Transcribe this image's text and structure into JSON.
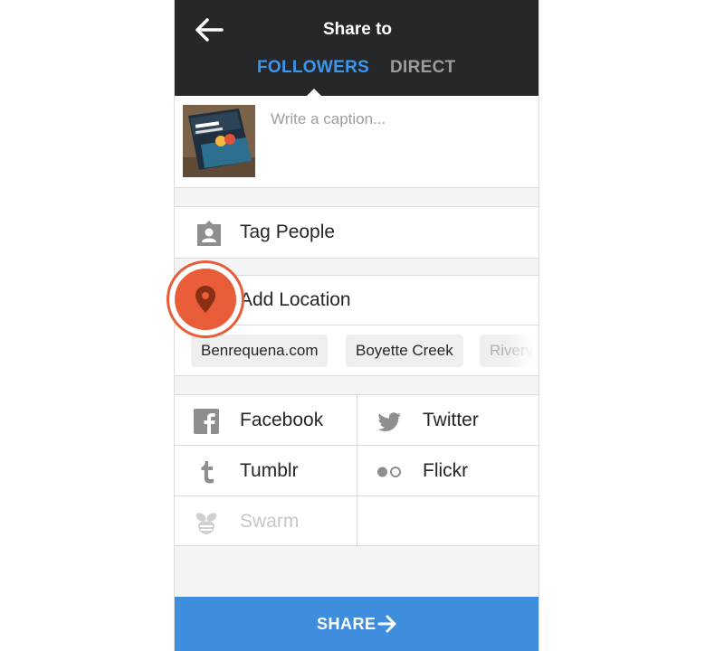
{
  "header": {
    "title": "Share to",
    "tabs": [
      {
        "label": "FOLLOWERS",
        "active": true
      },
      {
        "label": "DIRECT",
        "active": false
      }
    ],
    "back_icon": "arrow-left-icon"
  },
  "caption": {
    "placeholder": "Write a caption...",
    "value": ""
  },
  "options": {
    "tag_people": {
      "label": "Tag People",
      "icon": "person-tag-icon"
    },
    "add_location": {
      "label": "Add Location",
      "icon": "location-pin-icon"
    }
  },
  "location_suggestions": [
    "Benrequena.com",
    "Boyette Creek",
    "Riverv"
  ],
  "social": {
    "facebook": {
      "label": "Facebook",
      "icon": "facebook-icon"
    },
    "twitter": {
      "label": "Twitter",
      "icon": "twitter-icon"
    },
    "tumblr": {
      "label": "Tumblr",
      "icon": "tumblr-icon"
    },
    "flickr": {
      "label": "Flickr",
      "icon": "flickr-icon"
    },
    "swarm": {
      "label": "Swarm",
      "icon": "swarm-icon",
      "disabled": true
    }
  },
  "share_button": {
    "label": "SHARE",
    "icon": "arrow-right-icon"
  },
  "colors": {
    "header_bg": "#262729",
    "active_tab": "#3897f0",
    "inactive_tab": "#9c9c9c",
    "share_bg": "#3e8edd",
    "highlight": "#e85c38"
  }
}
